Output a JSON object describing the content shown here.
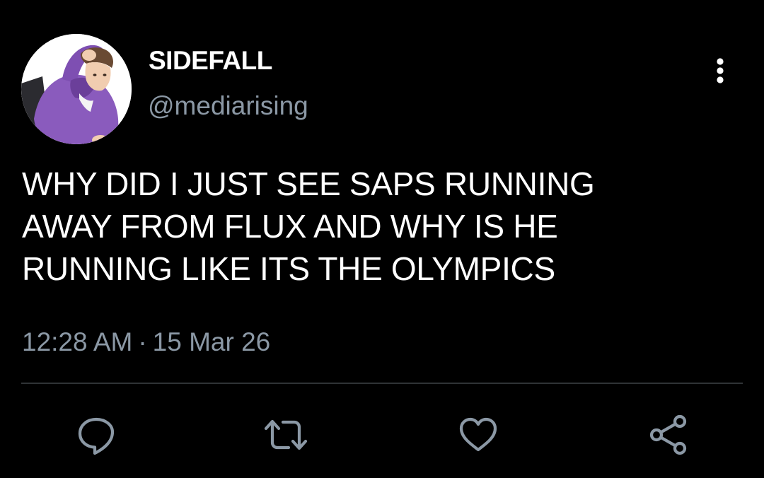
{
  "author": {
    "display_name": "SIDEFALL",
    "handle": "@mediarising",
    "avatar_icon": "profile-photo"
  },
  "tweet": {
    "text_lines": [
      "WHY DID I JUST SEE SAPS RUNNING",
      "AWAY FROM FLUX AND WHY IS HE",
      "RUNNING LIKE ITS THE OLYMPICS"
    ],
    "time": "12:28 AM",
    "separator": "·",
    "date": "15 Mar 26"
  },
  "icons": {
    "more": "more-vertical-icon",
    "reply": "reply-icon",
    "retweet": "retweet-icon",
    "like": "heart-icon",
    "share": "share-icon"
  },
  "colors": {
    "background": "#000000",
    "text": "#ffffff",
    "secondary_text": "#8b98a5",
    "divider": "#2f3336",
    "avatar_accent": "#8a5bbd"
  }
}
